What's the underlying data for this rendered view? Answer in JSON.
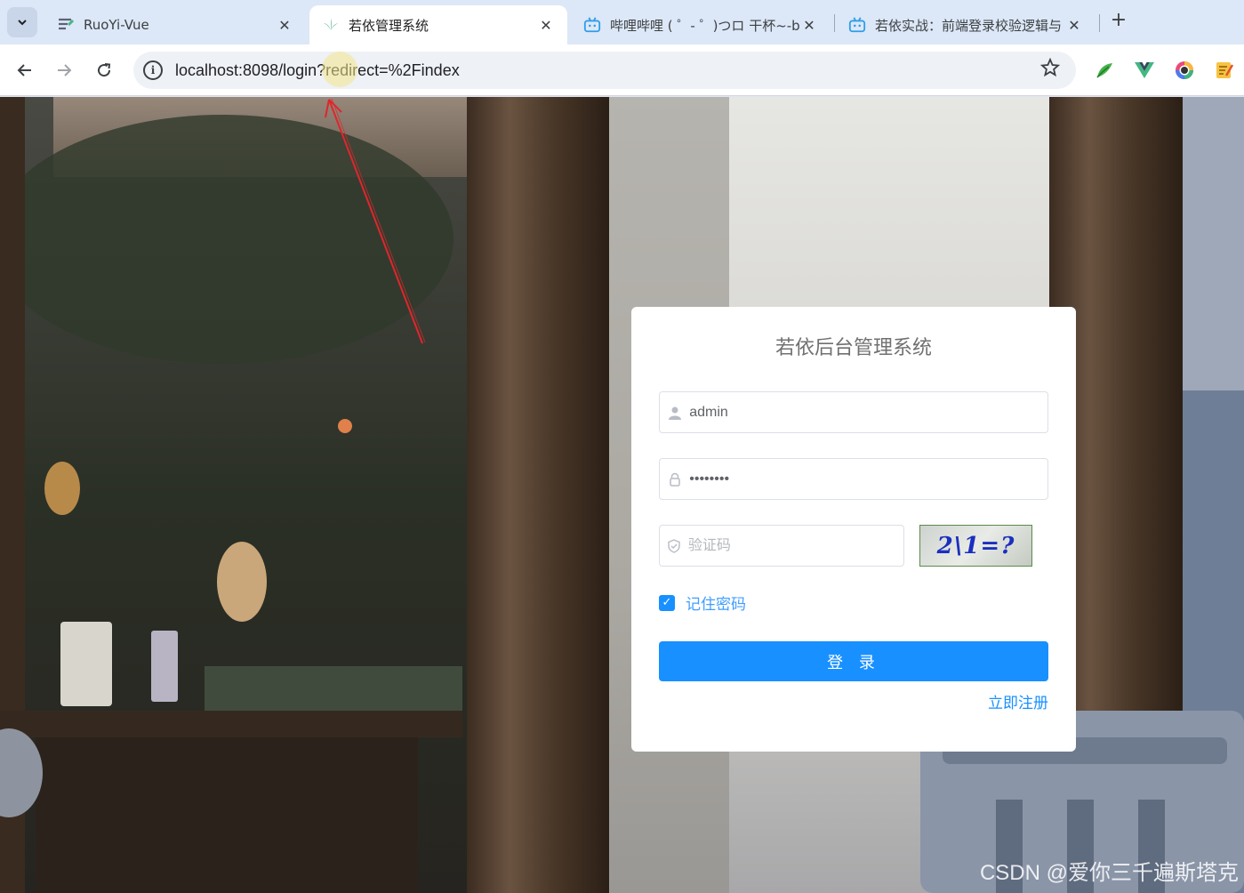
{
  "browser": {
    "tabs": [
      {
        "title": "RuoYi-Vue",
        "icon": "ruoyi-docs-icon"
      },
      {
        "title": "若依管理系统",
        "icon": "ruoyi-leaf-icon"
      },
      {
        "title": "哔哩哔哩 ( ゜- ゜)つロ 干杯~-bi",
        "icon": "bilibili-icon"
      },
      {
        "title": "若依实战：前端登录校验逻辑与",
        "icon": "bilibili-icon"
      }
    ],
    "close_glyph": "✕",
    "new_tab_glyph": "+",
    "url": "localhost:8098/login?redirect=%2Findex",
    "site_info_glyph": "i"
  },
  "login": {
    "title": "若依后台管理系统",
    "username_value": "admin",
    "password_value": "••••••••",
    "captcha_placeholder": "验证码",
    "captcha_text": "2\\1=?",
    "remember_label": "记住密码",
    "remember_checked": true,
    "login_button": "登 录",
    "register_link": "立即注册"
  },
  "watermark": "CSDN @爱你三千遍斯塔克",
  "colors": {
    "primary": "#1890ff",
    "annotation_arrow": "#e0262c"
  }
}
